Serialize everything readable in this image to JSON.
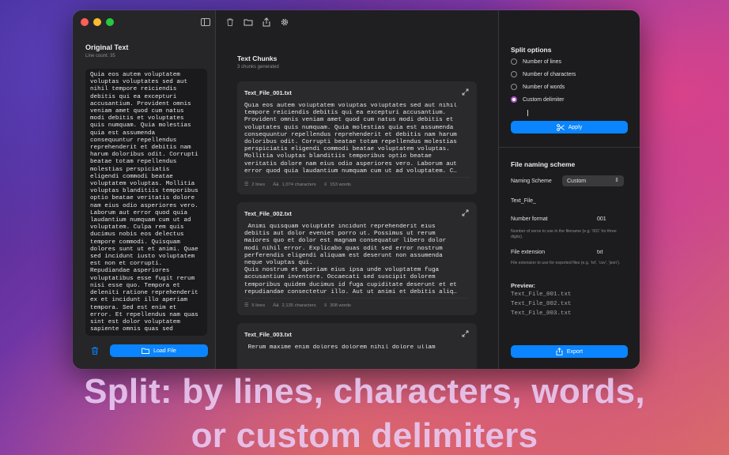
{
  "left": {
    "title": "Original Text",
    "line_count": "Line count: 35",
    "text": "Quia eos autem voluptatem\nvoluptas voluptates sed aut\nnihil tempore reiciendis\ndebitis qui ea excepturi\naccusantium. Provident omnis\nveniam amet quod cum natus\nmodi debitis et voluptates\nquis numquam. Quia molestias\nquia est assumenda\nconsequuntur repellendus\nreprehenderit et debitis nam\nharum doloribus odit. Corrupti\nbeatae totam repellendus\nmolestias perspiciatis\neligendi commodi beatae\nvoluptatem voluptas. Mollitia\nvoluptas blanditiis temporibus\noptio beatae veritatis dolore\nnam eius odio asperiores vero.\nLaborum aut error quod quia\nlaudantium numquam cum ut ad\nvoluptatem. Culpa rem quis\nducimus nobis eos delectus\ntempore commodi. Quisquam\ndolores sunt ut et animi. Quae\nsed incidunt iusto voluptatem\nest non et corrupti.\nRepudiandae asperiores\nvoluptatibus esse fugit rerum\nnisi esse quo. Tempora et\ndeleniti ratione reprehenderit\nex et incidunt illo aperiam\ntempora. Sed est enim et\nerror. Et repellendus nam quas\nsint est dolor voluptatem\nsapiente omnis quas sed",
    "load_button": "Load File"
  },
  "middle": {
    "title": "Text Chunks",
    "subtitle": "3 chunks generated",
    "chunks": [
      {
        "name": "Text_File_001.txt",
        "text": "Quia eos autem voluptatem voluptas voluptates sed aut nihil\ntempore reiciendis debitis qui ea excepturi accusantium.\nProvident omnis veniam amet quod cum natus modi debitis et\nvoluptates quis numquam. Quia molestias quia est assumenda\nconsequuntur repellendus reprehenderit et debitis nam harum\ndoloribus odit. Corrupti beatae totam repellendus molestias\nperspiciatis eligendi commodi beatae voluptatem voluptas.\nMollitia voluptas blanditiis temporibus optio beatae\nveritatis dolore nam eius odio asperiores vero. Laborum aut\nerror quod quia laudantium numquam cum ut ad voluptatem. C…",
        "lines": "2 lines",
        "characters": "1,074 characters",
        "words": "153 words"
      },
      {
        "name": "Text_File_002.txt",
        "text": " Animi quisquam voluptate incidunt reprehenderit eius\ndebitis aut dolor eveniet porro ut. Possimus ut rerum\nmaiores quo et dolor est magnam consequatur libero dolor\nmodi nihil error. Explicabo quas odit sed error nostrum\nperferendis eligendi aliquam est deserunt non assumenda\nneque voluptas qui.\nQuis nostrum et aperiam eius ipsa unde voluptatem fuga\naccusantium inventore. Occaecati sed suscipit dolorem\ntemporibus quidem ducimus id fuga cupiditate deserunt et et\nrepudiandae consectetur illo. Aut ut animi et debitis aliq…",
        "lines": "5 lines",
        "characters": "2,135 characters",
        "words": "308 words"
      },
      {
        "name": "Text_File_003.txt",
        "text": " Rerum maxime enim dolores dolorem nihil dolore ullam",
        "lines": "",
        "characters": "",
        "words": ""
      }
    ]
  },
  "right": {
    "split_title": "Split options",
    "options": [
      {
        "label": "Number of lines",
        "selected": false
      },
      {
        "label": "Number of characters",
        "selected": false
      },
      {
        "label": "Number of words",
        "selected": false
      },
      {
        "label": "Custom delimiter",
        "selected": true
      }
    ],
    "apply_button": "Apply",
    "naming_title": "File naming scheme",
    "naming_scheme_label": "Naming Scheme",
    "naming_scheme_value": "Custom",
    "prefix_value": "Text_File_",
    "number_format_label": "Number format",
    "number_format_value": "001",
    "number_format_hint": "Number of zeros to use in the filename (e.g. '001' for three digits).",
    "file_ext_label": "File extension",
    "file_ext_value": "txt",
    "file_ext_hint": "File extension to use for exported files (e.g. 'txt', 'csv', 'json').",
    "preview_label": "Preview:",
    "preview": [
      "Text_File_001.txt",
      "Text_File_002.txt",
      "Text_File_003.txt"
    ],
    "export_button": "Export"
  },
  "caption": {
    "line1": "Split: by lines, characters, words,",
    "line2": "or custom delimiters"
  },
  "colors": {
    "accent": "#0a84ff",
    "radio_selected": "#a855c8",
    "window_bg": "#1e1e20"
  },
  "icons": [
    "sidebar-toggle-icon",
    "trash-icon",
    "folder-icon",
    "share-icon",
    "gear-icon",
    "expand-icon",
    "scissors-icon",
    "lines-icon",
    "characters-icon",
    "words-icon",
    "chevron-updown-icon"
  ]
}
